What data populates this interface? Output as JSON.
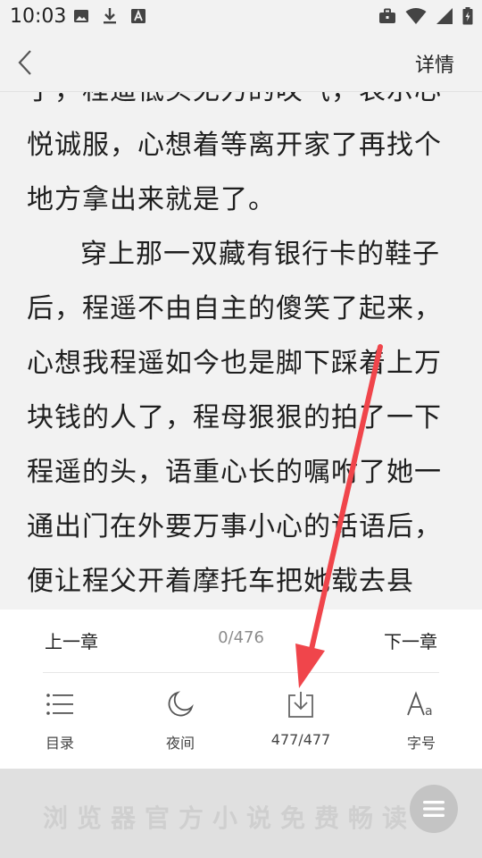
{
  "status_bar": {
    "time": "10:03",
    "left_icons": [
      "image-icon",
      "download-icon",
      "font-badge-icon"
    ],
    "right_icons": [
      "briefcase-icon",
      "wifi-icon",
      "signal-icon",
      "battery-icon"
    ]
  },
  "header": {
    "back_icon": "chevron-left-icon",
    "detail_label": "详情"
  },
  "content": {
    "paragraphs": [
      "了，程遥低头无力的叹气，表示心悦诚服，心想着等离开家了再找个地方拿出来就是了。",
      "穿上那一双藏有银行卡的鞋子后，程遥不由自主的傻笑了起来，心想我程遥如今也是脚下踩着上万块钱的人了，程母狠狠的拍了一下程遥的头，语重心长的嘱咐了她一通出门在外要万事小心的话语后，便让程父开着摩托车把她载去县城。"
    ]
  },
  "chapter_nav": {
    "prev_label": "上一章",
    "progress": "0/476",
    "next_label": "下一章"
  },
  "toolbar": {
    "catalog_label": "目录",
    "night_label": "夜间",
    "download_label": "477/477",
    "font_label": "字号"
  },
  "banner": {
    "text": "浏览器官方小说免费畅读"
  },
  "colors": {
    "background": "#f2f2f2",
    "panel": "#ffffff",
    "annotation_arrow": "#f0454b"
  }
}
